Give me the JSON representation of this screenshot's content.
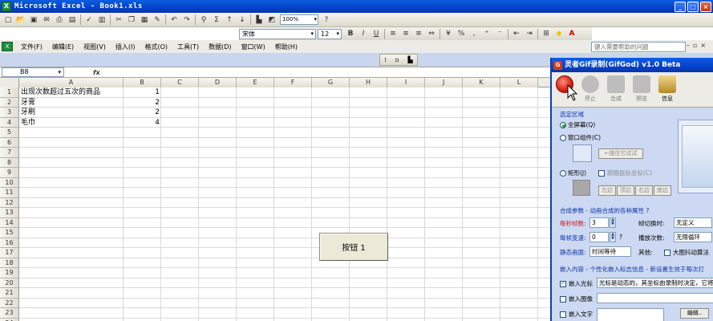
{
  "window": {
    "title": "Microsoft Excel - Book1.xls",
    "minimize": "_",
    "maximize": "□",
    "close": "×"
  },
  "toolbar": {
    "zoom": "100%"
  },
  "format_bar": {
    "font": "宋体",
    "size": "12",
    "bold": "B",
    "italic": "I",
    "underline": "U"
  },
  "menu": {
    "items": [
      "文件(F)",
      "编辑(E)",
      "视图(V)",
      "插入(I)",
      "格式(O)",
      "工具(T)",
      "数据(D)",
      "窗口(W)",
      "帮助(H)"
    ],
    "help_placeholder": "键入需要帮助的问题"
  },
  "formula_bar": {
    "name_box": "B8",
    "fx": "fx"
  },
  "sheet": {
    "columns": [
      "A",
      "B",
      "C",
      "D",
      "E",
      "F",
      "G",
      "H",
      "I",
      "J",
      "K",
      "L"
    ],
    "rows": [
      "1",
      "2",
      "3",
      "4",
      "5",
      "6",
      "7",
      "8",
      "9",
      "10",
      "11",
      "12",
      "13",
      "14",
      "15",
      "16",
      "17",
      "18",
      "19",
      "20",
      "21",
      "22",
      "23",
      "24"
    ],
    "cells": [
      {
        "a": "出现次数超过五次的商品",
        "b": "1"
      },
      {
        "a": "牙膏",
        "b": "2"
      },
      {
        "a": "牙刷",
        "b": "2"
      },
      {
        "a": "毛巾",
        "b": "4"
      }
    ],
    "button_label": "按钮 1"
  },
  "gifgod": {
    "title": "灵者Gif录制(GifGod) v1.0 Beta",
    "tools": [
      "",
      "停止",
      "合成",
      "预览",
      "信息"
    ],
    "section_area": "选定区域",
    "opt_fullscreen": "全屏幕(Q)",
    "opt_window": "窗口组件(C)",
    "btn_press_window": "←按住它试试",
    "opt_rect": "矩形(J)",
    "opt_follow": "跟随鼠标坐标(C)",
    "edge_btns": [
      "左边",
      "顶边",
      "右边",
      "底边"
    ],
    "section_params": "合成参数 - 动画合成的各种属性  ?",
    "fps_label": "每秒帧数:",
    "fps_value": "3",
    "switch_label": "帧切换时:",
    "switch_value": "无定义",
    "speed_label": "每帧变速:",
    "speed_value": "0",
    "speed_q": "?",
    "play_label": "播放次数:",
    "play_value": "无限循环",
    "static_label": "静态画面:",
    "static_value": "时间等待",
    "other_label": "其他:",
    "big_label": "大图抖动算法",
    "section_embed": "嵌入内容 - 个性化嵌入标志信息 - 新设置生效于每次打",
    "embed_cursor": "嵌入光标",
    "cursor_text": "光标是动态的，其坐标由录制时决定，它将",
    "embed_image": "嵌入图像",
    "embed_text": "嵌入文字",
    "edit_btn": "编辑.."
  }
}
